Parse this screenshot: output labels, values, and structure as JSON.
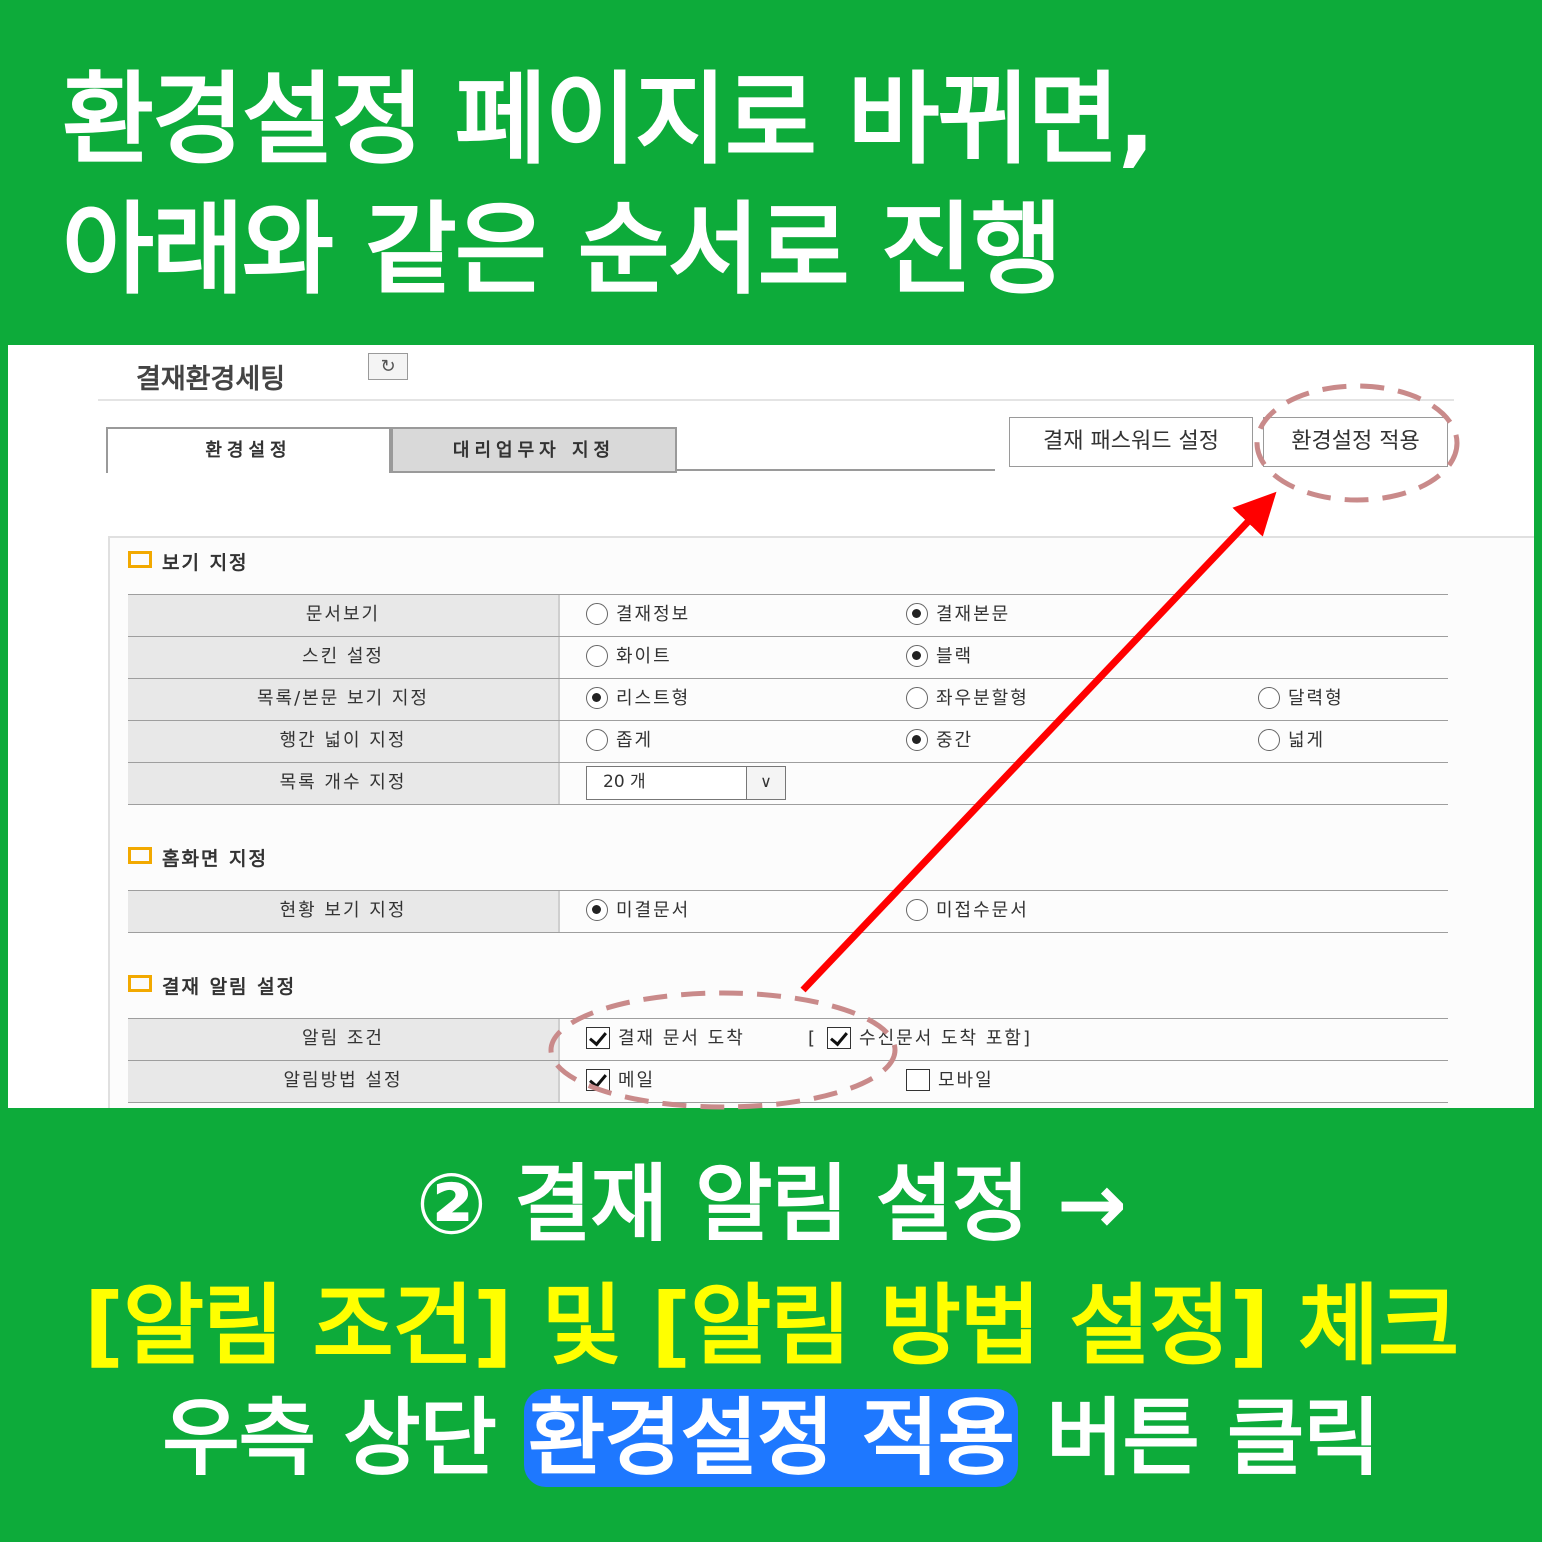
{
  "headline": {
    "line1": "환경설정 페이지로 바뀌면,",
    "line2": "아래와 같은 순서로 진행"
  },
  "panel": {
    "title": "결재환경세팅",
    "refresh_icon": "refresh-icon",
    "tabs": [
      {
        "label": "환경설정",
        "active": true
      },
      {
        "label": "대리업무자 지정",
        "active": false
      }
    ],
    "buttons": {
      "password": "결재 패스워드 설정",
      "apply": "환경설정 적용"
    },
    "sections": {
      "view": {
        "title": "보기 지정",
        "rows": [
          {
            "label": "문서보기",
            "options": [
              {
                "text": "결재정보",
                "checked": false
              },
              {
                "text": "결재본문",
                "checked": true
              }
            ]
          },
          {
            "label": "스킨 설정",
            "options": [
              {
                "text": "화이트",
                "checked": false
              },
              {
                "text": "블랙",
                "checked": true
              }
            ]
          },
          {
            "label": "목록/본문 보기 지정",
            "options": [
              {
                "text": "리스트형",
                "checked": true
              },
              {
                "text": "좌우분할형",
                "checked": false
              },
              {
                "text": "달력형",
                "checked": false
              }
            ]
          },
          {
            "label": "행간 넓이 지정",
            "options": [
              {
                "text": "좁게",
                "checked": false
              },
              {
                "text": "중간",
                "checked": true
              },
              {
                "text": "넓게",
                "checked": false
              }
            ]
          },
          {
            "label": "목록 개수 지정",
            "select_value": "20 개"
          }
        ]
      },
      "home": {
        "title": "홈화면 지정",
        "rows": [
          {
            "label": "현황 보기 지정",
            "options": [
              {
                "text": "미결문서",
                "checked": true
              },
              {
                "text": "미접수문서",
                "checked": false
              }
            ]
          }
        ]
      },
      "alert": {
        "title": "결재 알림 설정",
        "rows": [
          {
            "label": "알림 조건",
            "options": [
              {
                "text": "결재 문서 도착",
                "checked": true
              },
              {
                "text": "수신문서 도착 포함]",
                "checked": true,
                "prefix": "["
              }
            ]
          },
          {
            "label": "알림방법 설정",
            "options": [
              {
                "text": "메일",
                "checked": true
              },
              {
                "text": "모바일",
                "checked": false
              }
            ]
          }
        ]
      }
    }
  },
  "annotation": {
    "arrow_color": "#ff0000",
    "circle_color": "#c98a8a"
  },
  "bottom": {
    "line1": "② 결재 알림 설정 →",
    "line2": "[알림 조건] 및 [알림 방법 설정] 체크",
    "line3_pre": "우측 상단",
    "line3_highlight": "환경설정 적용",
    "line3_post": "버튼 클릭"
  },
  "colors": {
    "background": "#0dab3a",
    "highlight": "#1e78ff",
    "yellow_text": "#ffff00",
    "section_mark": "#f2a900"
  }
}
